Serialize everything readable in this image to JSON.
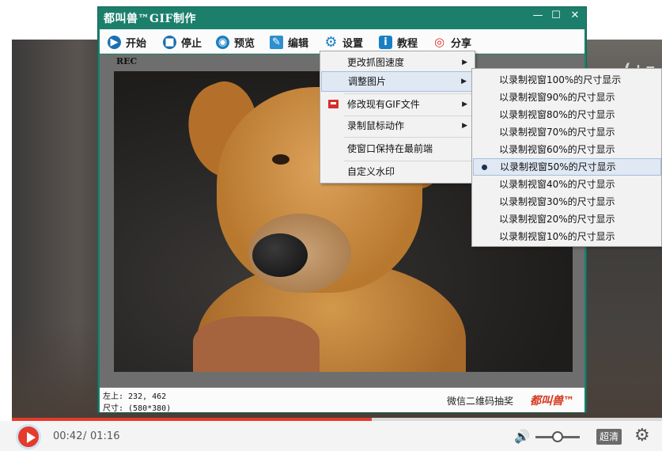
{
  "video_player": {
    "watermark": "(+z",
    "current_time": "00:42",
    "separator": "/",
    "total_time": "01:16",
    "progress": 0.553,
    "volume": 0.45,
    "quality_label": "超清"
  },
  "gif_app": {
    "title": "都叫兽™GIF制作",
    "window_controls": {
      "minimize": "—",
      "maximize": "☐",
      "close": "✕"
    },
    "toolbar": [
      {
        "label": "开始",
        "icon": "play-icon"
      },
      {
        "label": "停止",
        "icon": "stop-icon"
      },
      {
        "label": "预览",
        "icon": "preview-icon"
      },
      {
        "label": "编辑",
        "icon": "edit-icon"
      },
      {
        "label": "设置",
        "icon": "gear-icon"
      },
      {
        "label": "教程",
        "icon": "info-icon"
      },
      {
        "label": "分享",
        "icon": "weibo-icon"
      }
    ],
    "rec_label": "REC",
    "position_text": "左上: 232, 462",
    "size_text": "尺寸: (580*380)",
    "qr_text": "微信二维码抽奖",
    "logo_text": "都叫兽™"
  },
  "settings_menu": {
    "items": [
      {
        "label": "更改抓图速度",
        "has_submenu": true
      },
      {
        "label": "调整图片",
        "has_submenu": true,
        "active": true
      },
      {
        "label": "修改现有GIF文件",
        "has_submenu": true,
        "icon": "gif-file-icon"
      },
      {
        "label": "录制鼠标动作",
        "has_submenu": true
      },
      {
        "label": "使窗口保持在最前端",
        "has_submenu": false
      },
      {
        "label": "自定义水印",
        "has_submenu": false
      }
    ]
  },
  "resize_submenu": {
    "items": [
      {
        "label": "以录制视窗100%的尺寸显示"
      },
      {
        "label": "以录制视窗90%的尺寸显示"
      },
      {
        "label": "以录制视窗80%的尺寸显示"
      },
      {
        "label": "以录制视窗70%的尺寸显示"
      },
      {
        "label": "以录制视窗60%的尺寸显示"
      },
      {
        "label": "以录制视窗50%的尺寸显示",
        "selected": true
      },
      {
        "label": "以录制视窗40%的尺寸显示"
      },
      {
        "label": "以录制视窗30%的尺寸显示"
      },
      {
        "label": "以录制视窗20%的尺寸显示"
      },
      {
        "label": "以录制视窗10%的尺寸显示"
      }
    ]
  },
  "colors": {
    "app_frame": "#1b7f6c",
    "progress_red": "#e53b2c",
    "menu_highlight": "#dfe8f3"
  }
}
